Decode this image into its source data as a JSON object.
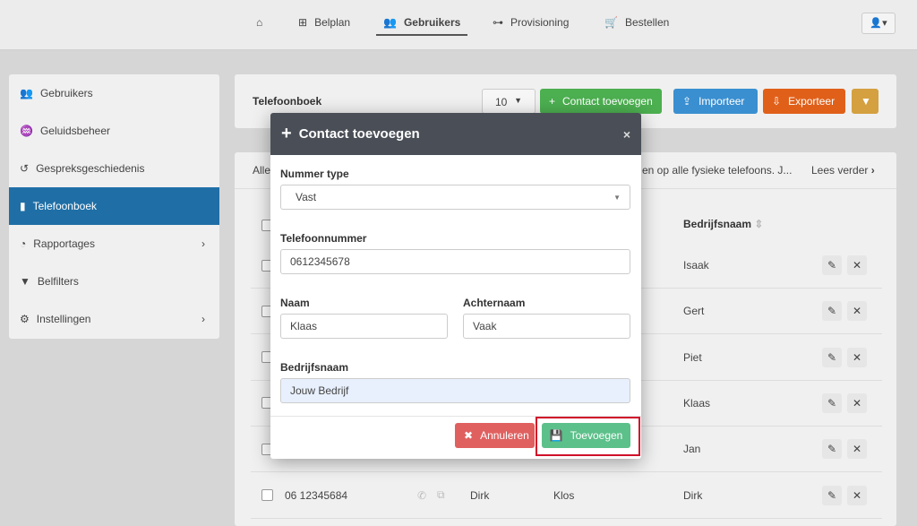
{
  "nav": {
    "items": [
      {
        "label": "",
        "icon": "home-icon"
      },
      {
        "label": "Belplan",
        "icon": "sitemap-icon"
      },
      {
        "label": "Gebruikers",
        "icon": "users-icon"
      },
      {
        "label": "Provisioning",
        "icon": "network-icon"
      },
      {
        "label": "Bestellen",
        "icon": "cart-icon"
      }
    ],
    "user_caret": "▾"
  },
  "sidebar": {
    "items": [
      {
        "label": "Gebruikers"
      },
      {
        "label": "Geluidsbeheer"
      },
      {
        "label": "Gespreksgeschiedenis"
      },
      {
        "label": "Telefoonboek"
      },
      {
        "label": "Rapportages",
        "chev": "›"
      },
      {
        "label": "Belfilters"
      },
      {
        "label": "Instellingen",
        "chev": "›"
      }
    ]
  },
  "toolbar": {
    "title": "Telefoonboek",
    "page_size": "10",
    "add": "Contact toevoegen",
    "import": "Importeer",
    "export": "Exporteer"
  },
  "info": {
    "left": "Alle",
    "right": "en op alle fysieke telefoons. J...",
    "read_more": "Lees verder"
  },
  "table": {
    "col_company": "Bedrijfsnaam",
    "rows": [
      {
        "company": "Isaak"
      },
      {
        "company": "Gert"
      },
      {
        "company": "Piet"
      },
      {
        "company": "Klaas"
      },
      {
        "company": "Jan"
      },
      {
        "number": "06 12345684",
        "first": "Dirk",
        "last": "Klos",
        "company": "Dirk"
      }
    ]
  },
  "modal": {
    "title": "Contact toevoegen",
    "close": "×",
    "type_label": "Nummer type",
    "type_value": "Vast",
    "phone_label": "Telefoonnummer",
    "phone_value": "0612345678",
    "name_label": "Naam",
    "name_value": "Klaas",
    "surname_label": "Achternaam",
    "surname_value": "Vaak",
    "company_label": "Bedrijfsnaam",
    "company_value": "Jouw Bedrijf",
    "cancel": "Annuleren",
    "submit": "Toevoegen"
  },
  "colors": {
    "primary": "#1f6fa6",
    "green": "#4caf50",
    "blue": "#3a8fd0",
    "orange": "#e0601a",
    "danger": "#e06060",
    "success": "#5cc08a",
    "highlight": "#d0102a"
  }
}
